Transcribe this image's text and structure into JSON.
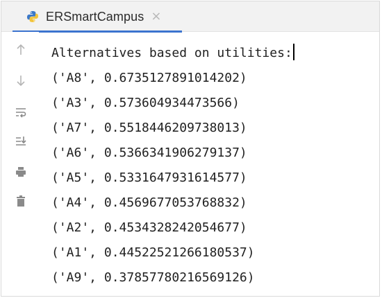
{
  "tab": {
    "title": "ERSmartCampus",
    "close_glyph": "×"
  },
  "toolbar": {
    "icons": [
      "up-arrow-icon",
      "down-arrow-icon",
      "soft-wrap-icon",
      "scroll-to-end-icon",
      "print-icon",
      "trash-icon"
    ]
  },
  "console": {
    "header": "Alternatives based on utilities:",
    "lines": [
      "('A8', 0.6735127891014202)",
      "('A3', 0.573604934473566)",
      "('A7', 0.5518446209738013)",
      "('A6', 0.5366341906279137)",
      "('A5', 0.5331647931614577)",
      "('A4', 0.4569677053768832)",
      "('A2', 0.4534328242054677)",
      "('A1', 0.44522521266180537)",
      "('A9', 0.37857780216569126)"
    ]
  },
  "colors": {
    "accent": "#3b73cf",
    "icon": "#8a8a8a",
    "text": "#1f1f1f"
  }
}
